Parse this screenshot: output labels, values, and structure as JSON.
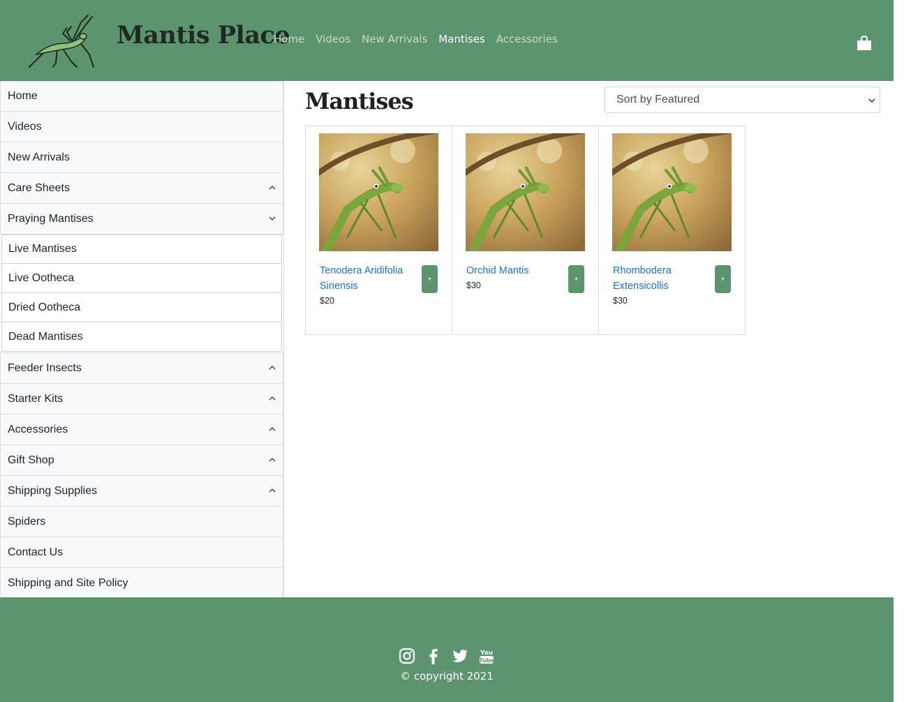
{
  "header": {
    "brand": "Mantis Place",
    "nav": [
      {
        "label": "Home",
        "active": false
      },
      {
        "label": "Videos",
        "active": false
      },
      {
        "label": "New Arrivals",
        "active": false
      },
      {
        "label": "Mantises",
        "active": true
      },
      {
        "label": "Accessories",
        "active": false
      }
    ],
    "cart_icon": "shopping-bag-icon",
    "background": "#5b946e"
  },
  "sidebar": {
    "items": [
      {
        "label": "Home"
      },
      {
        "label": "Videos"
      },
      {
        "label": "New Arrivals"
      },
      {
        "label": "Care Sheets",
        "chevron": "up"
      },
      {
        "label": "Praying Mantises",
        "chevron": "down",
        "children": [
          "Live Mantises",
          "Live Ootheca",
          "Dried Ootheca",
          "Dead Mantises"
        ]
      },
      {
        "label": "Feeder Insects",
        "chevron": "up"
      },
      {
        "label": "Starter Kits",
        "chevron": "up"
      },
      {
        "label": "Accessories",
        "chevron": "up"
      },
      {
        "label": "Gift Shop",
        "chevron": "up"
      },
      {
        "label": "Shipping Supplies",
        "chevron": "up"
      },
      {
        "label": "Spiders"
      },
      {
        "label": "Contact Us"
      },
      {
        "label": "Shipping and Site Policy"
      }
    ]
  },
  "main": {
    "title": "Mantises",
    "sort": {
      "selected": "Sort by Featured"
    },
    "products": [
      {
        "name": "Tenodera Aridifolia Sinensis",
        "price": "$20",
        "add_label": "+"
      },
      {
        "name": "Orchid Mantis",
        "price": "$30",
        "add_label": "+"
      },
      {
        "name": "Rhombodera Extensicollis",
        "price": "$30",
        "add_label": "+"
      }
    ]
  },
  "footer": {
    "social": [
      "instagram-icon",
      "facebook-icon",
      "twitter-icon",
      "youtube-icon"
    ],
    "copyright": "© copyright 2021",
    "background": "#5b946e"
  },
  "colors": {
    "accent": "#5b946e",
    "link": "#1a73e8"
  }
}
